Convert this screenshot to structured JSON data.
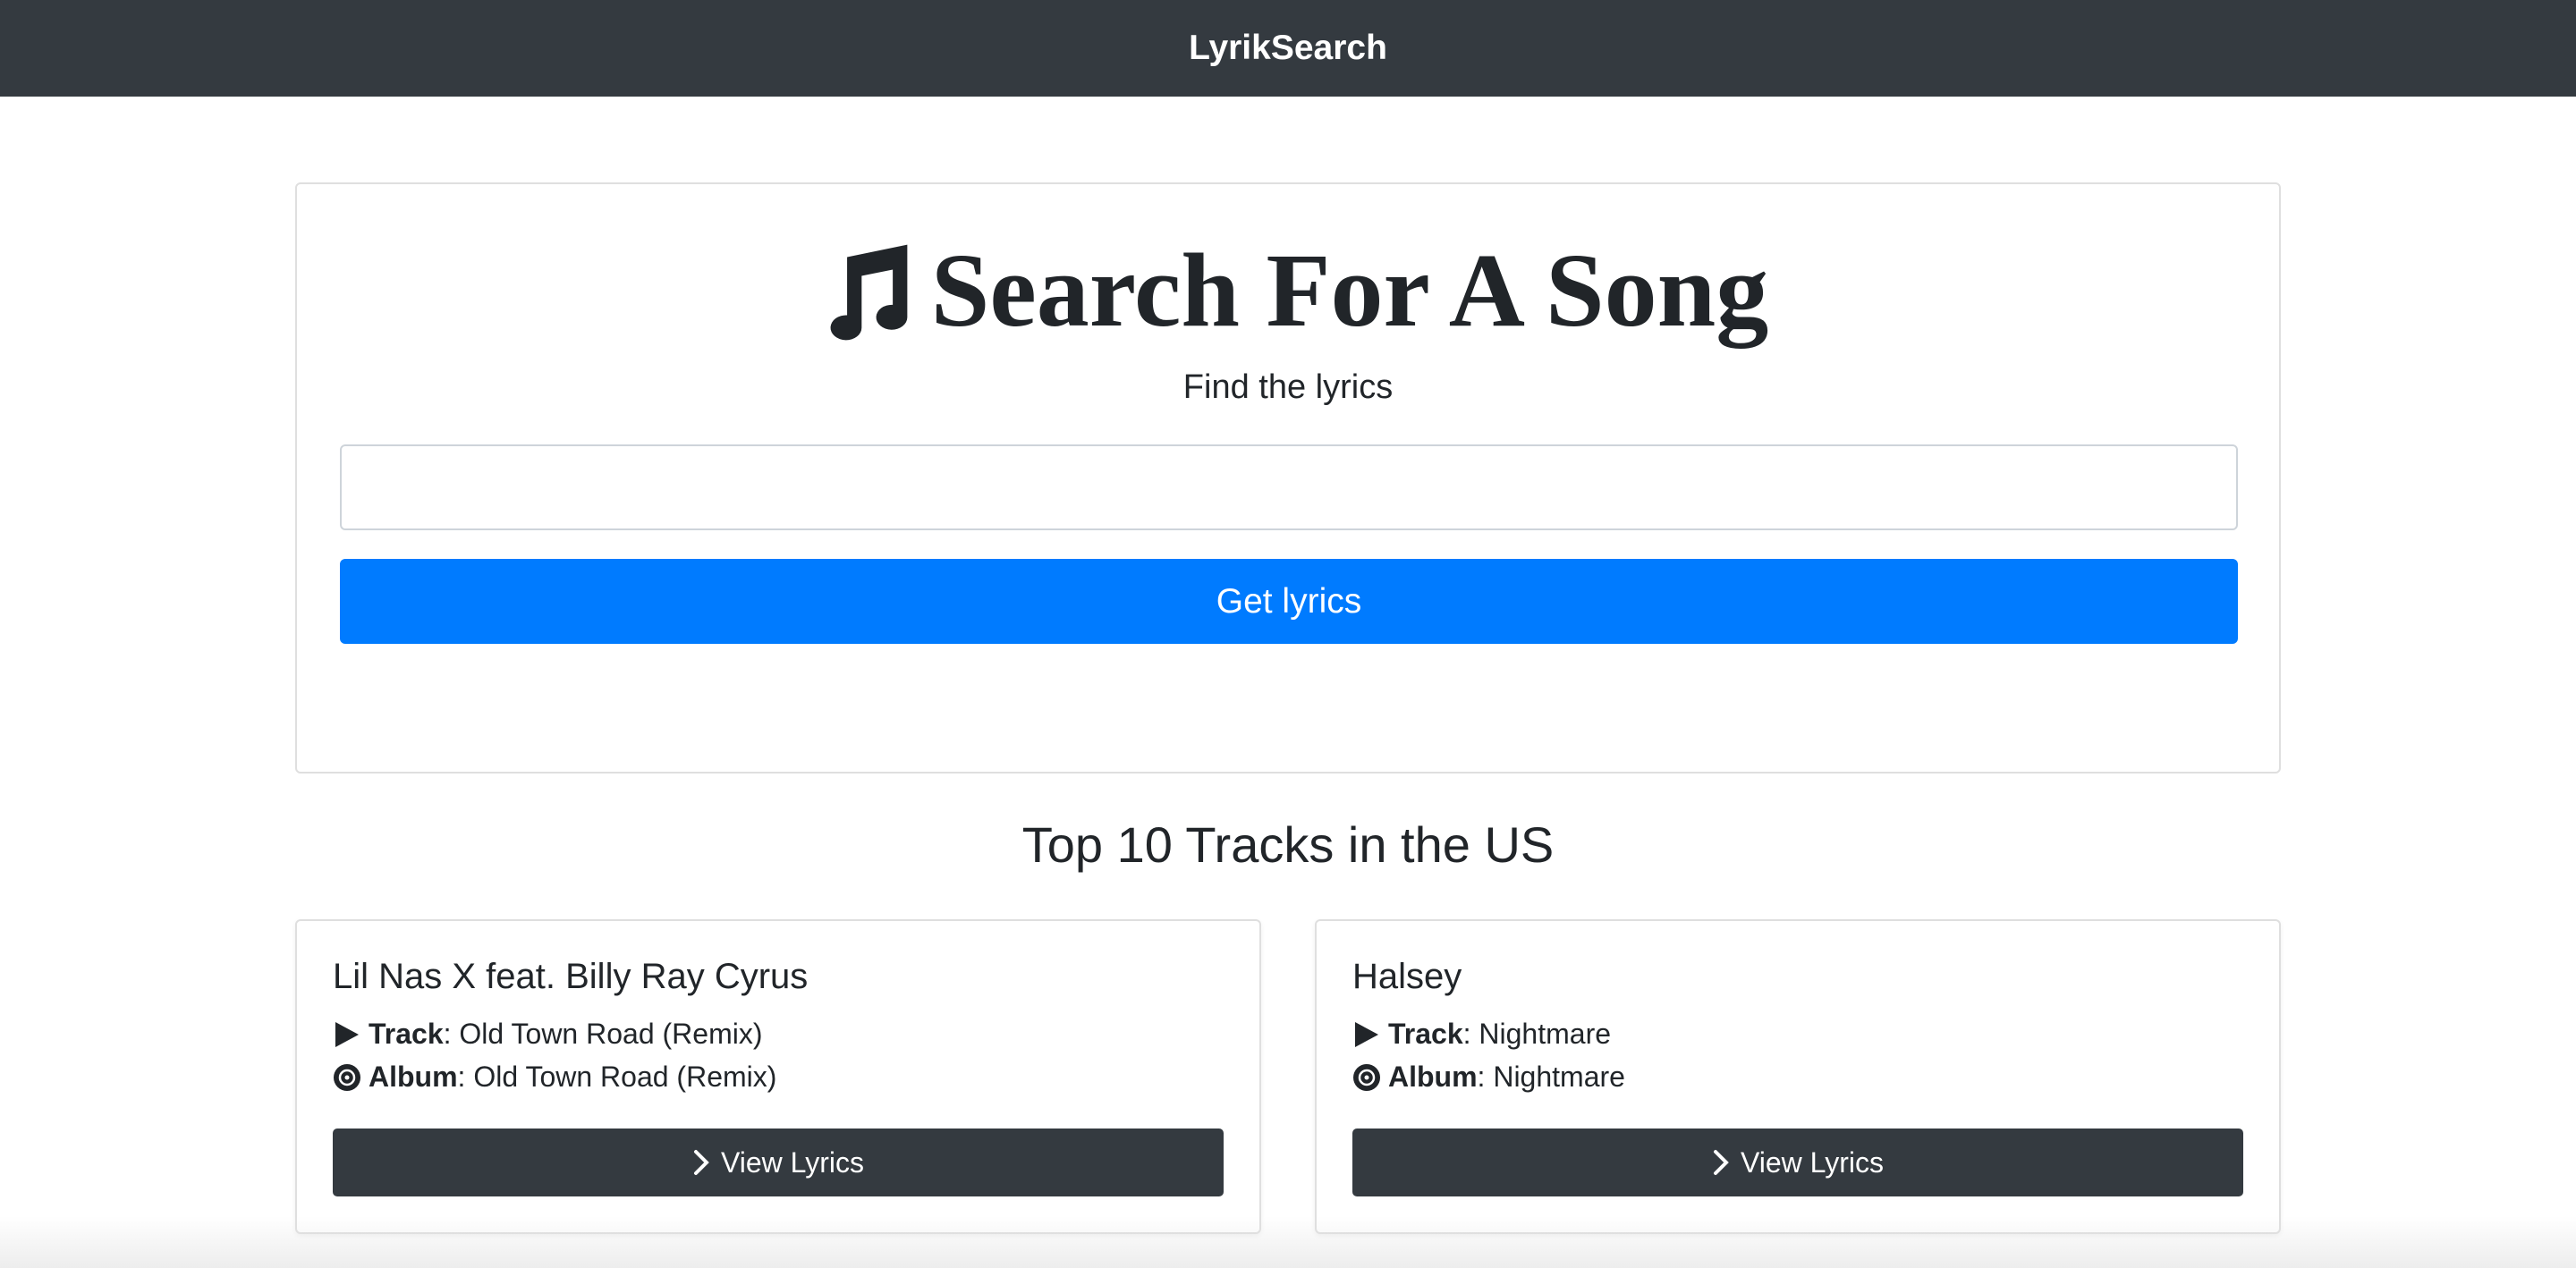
{
  "navbar": {
    "brand": "LyrikSearch"
  },
  "search": {
    "title": "Search For A Song",
    "subtitle": "Find the lyrics",
    "input_value": "",
    "input_placeholder": "",
    "button_label": "Get lyrics",
    "title_icon": "music-note-icon"
  },
  "top_tracks": {
    "heading": "Top 10 Tracks in the US",
    "track_label": "Track",
    "album_label": "Album",
    "view_button_label": "View Lyrics",
    "items": [
      {
        "artist": "Lil Nas X feat. Billy Ray Cyrus",
        "track": "Old Town Road (Remix)",
        "album": "Old Town Road (Remix)"
      },
      {
        "artist": "Halsey",
        "track": "Nightmare",
        "album": "Nightmare"
      }
    ]
  },
  "colors": {
    "navbar_bg": "#343a40",
    "primary": "#007bff",
    "dark_button": "#343a40",
    "text": "#212529"
  },
  "icons": {
    "track": "play-icon",
    "album": "album-disc-icon",
    "view": "chevron-right-icon"
  }
}
